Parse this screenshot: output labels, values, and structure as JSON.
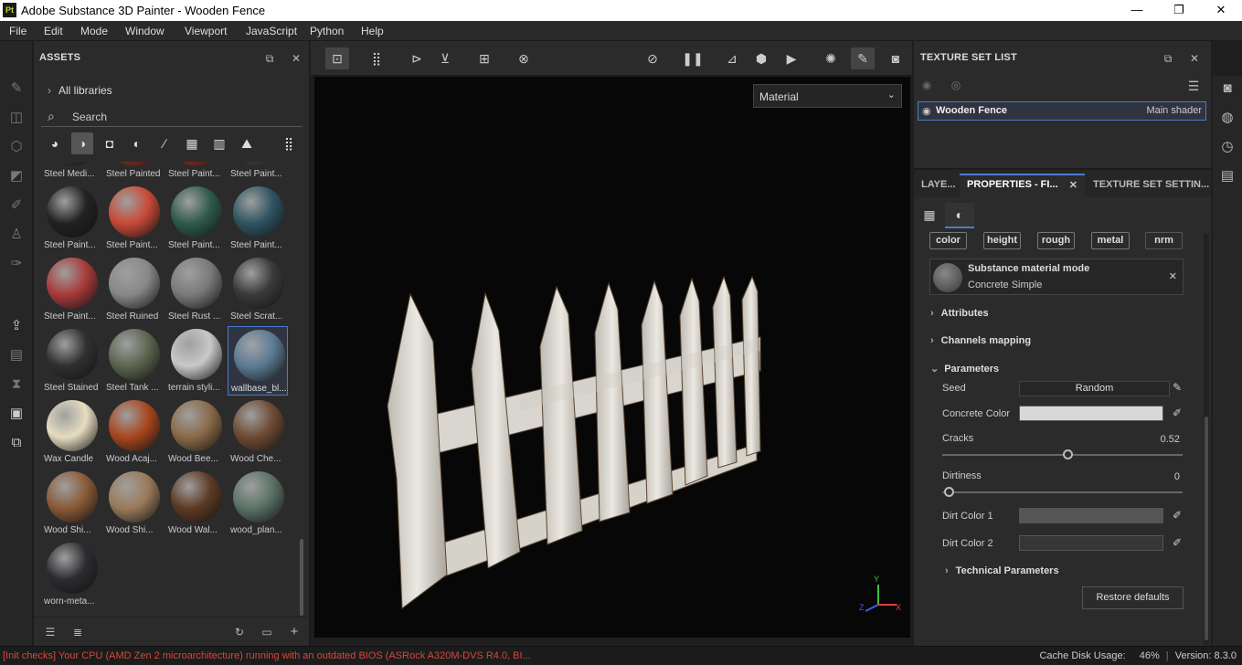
{
  "window": {
    "logo": "Pt",
    "title": "Adobe Substance 3D Painter - Wooden Fence",
    "minimize_glyph": "—",
    "maximize_glyph": "❐",
    "close_glyph": "✕"
  },
  "menu": [
    "File",
    "Edit",
    "Mode",
    "Window",
    "Viewport",
    "JavaScript",
    "Python",
    "Help"
  ],
  "assets": {
    "title": "ASSETS",
    "all_libraries": "All libraries",
    "search_placeholder": "Search",
    "items": [
      {
        "label": "Steel Medi...",
        "color": "#3a3a3a"
      },
      {
        "label": "Steel Painted",
        "color": "#a8332c"
      },
      {
        "label": "Steel Paint...",
        "color": "#a8332c"
      },
      {
        "label": "Steel Paint...",
        "color": "#4a4a4a"
      },
      {
        "label": "Steel Paint...",
        "color": "#222222"
      },
      {
        "label": "Steel Paint...",
        "color": "#c84a38"
      },
      {
        "label": "Steel Paint...",
        "color": "#2f5a4c"
      },
      {
        "label": "Steel Paint...",
        "color": "#2e5462"
      },
      {
        "label": "Steel Paint...",
        "color": "#a83b3b"
      },
      {
        "label": "Steel Ruined",
        "color": "#888888"
      },
      {
        "label": "Steel Rust ...",
        "color": "#7a7a7a"
      },
      {
        "label": "Steel Scrat...",
        "color": "#3a3a3a"
      },
      {
        "label": "Steel Stained",
        "color": "#303030"
      },
      {
        "label": "Steel Tank ...",
        "color": "#5c6650"
      },
      {
        "label": "terrain styli...",
        "color": "#c8c8c8"
      },
      {
        "label": "wallbase_bl...",
        "color": "#5a7a92"
      },
      {
        "label": "Wax Candle",
        "color": "#e6dcc0"
      },
      {
        "label": "Wood Acaj...",
        "color": "#a8461e"
      },
      {
        "label": "Wood Bee...",
        "color": "#8a6a48"
      },
      {
        "label": "Wood Che...",
        "color": "#6e4a34"
      },
      {
        "label": "Wood Shi...",
        "color": "#8a5a38"
      },
      {
        "label": "Wood Shi...",
        "color": "#9a7a5a"
      },
      {
        "label": "Wood Wal...",
        "color": "#5e3a24"
      },
      {
        "label": "wood_plan...",
        "color": "#5a7266"
      },
      {
        "label": "worn-meta...",
        "color": "#2c2c30"
      }
    ]
  },
  "viewport": {
    "mode_select": "Material",
    "axis_x": "X",
    "axis_y": "Y",
    "axis_z": "Z"
  },
  "texture_set_list": {
    "title": "TEXTURE SET LIST",
    "row_name": "Wooden Fence",
    "row_shader": "Main shader"
  },
  "properties": {
    "tabs": [
      "LAYE...",
      "PROPERTIES - FI...",
      "TEXTURE SET SETTIN..."
    ],
    "channels": [
      "color",
      "height",
      "rough",
      "metal",
      "nrm"
    ],
    "material_mode_title": "Substance material mode",
    "material_mode_value": "Concrete Simple",
    "sections": {
      "attributes": "Attributes",
      "channels_mapping": "Channels mapping",
      "parameters": "Parameters",
      "technical": "Technical Parameters"
    },
    "params": {
      "seed_label": "Seed",
      "seed_value": "Random",
      "concrete_color_label": "Concrete Color",
      "concrete_color": "#d8d8d8",
      "cracks_label": "Cracks",
      "cracks_value": "0.52",
      "cracks_fraction": 0.52,
      "dirtiness_label": "Dirtiness",
      "dirtiness_value": "0",
      "dirtiness_fraction": 0,
      "dirt1_label": "Dirt Color 1",
      "dirt1_color": "#555555",
      "dirt2_label": "Dirt Color 2",
      "dirt2_color": "#363636"
    },
    "restore_defaults": "Restore defaults"
  },
  "status": {
    "error": "[Init checks] Your CPU (AMD Zen 2 microarchitecture) running with an outdated BIOS (ASRock A320M-DVS R4.0, BI...",
    "cache": "Cache Disk Usage:",
    "cache_value": "46%",
    "version": "Version: 8.3.0"
  }
}
